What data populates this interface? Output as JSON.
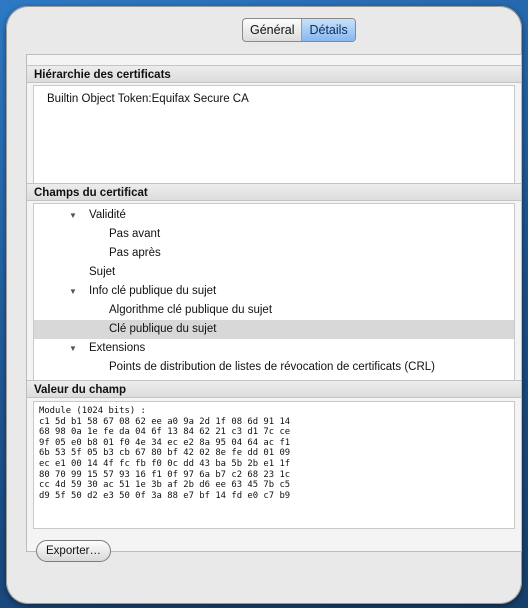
{
  "tabs": [
    {
      "label": "Général",
      "active": false
    },
    {
      "label": "Détails",
      "active": true
    }
  ],
  "hierarchy": {
    "title": "Hiérarchie des certificats",
    "entries": [
      "Builtin Object Token:Equifax Secure CA"
    ]
  },
  "fields": {
    "title": "Champs du certificat",
    "items": [
      {
        "label": "Validité",
        "level": 1,
        "expanded": true
      },
      {
        "label": "Pas avant",
        "level": 2
      },
      {
        "label": "Pas après",
        "level": 2
      },
      {
        "label": "Sujet",
        "level": 1
      },
      {
        "label": "Info clé publique du sujet",
        "level": 1,
        "expanded": true
      },
      {
        "label": "Algorithme clé publique du sujet",
        "level": 2
      },
      {
        "label": "Clé publique du sujet",
        "level": 2,
        "selected": true
      },
      {
        "label": "Extensions",
        "level": 1,
        "expanded": true
      },
      {
        "label": "Points de distribution de listes de révocation de certificats (CRL)",
        "level": 2
      }
    ]
  },
  "value": {
    "title": "Valeur du champ",
    "text": "Module (1024 bits) :\nc1 5d b1 58 67 08 62 ee a0 9a 2d 1f 08 6d 91 14\n68 98 0a 1e fe da 04 6f 13 84 62 21 c3 d1 7c ce\n9f 05 e0 b8 01 f0 4e 34 ec e2 8a 95 04 64 ac f1\n6b 53 5f 05 b3 cb 67 80 bf 42 02 8e fe dd 01 09\nec e1 00 14 4f fc fb f0 0c dd 43 ba 5b 2b e1 1f\n80 70 99 15 57 93 16 f1 0f 97 6a b7 c2 68 23 1c\ncc 4d 59 30 ac 51 1e 3b af 2b d6 ee 63 45 7b c5\nd9 5f 50 d2 e3 50 0f 3a 88 e7 bf 14 fd e0 c7 b9"
  },
  "export_label": "Exporter…",
  "colors": {
    "tab_active": "#86b8ee",
    "selection": "#d8d8d8",
    "window_edge": "#1f5c9a"
  }
}
